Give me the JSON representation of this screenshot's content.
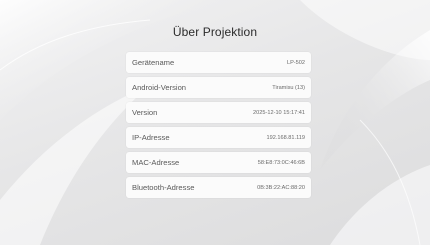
{
  "page": {
    "title": "Über Projektion"
  },
  "info_rows": [
    {
      "label": "Gerätename",
      "value": "LP-502"
    },
    {
      "label": "Android-Version",
      "value": "Tiramisu (13)"
    },
    {
      "label": "Version",
      "value": "2025-12-10 15:17:41"
    },
    {
      "label": "IP-Adresse",
      "value": "192.168.81.119"
    },
    {
      "label": "MAC-Adresse",
      "value": "58:E8:73:0C:46:6B"
    },
    {
      "label": "Bluetooth-Adresse",
      "value": "0B:3B:22:AC:88:20"
    }
  ]
}
